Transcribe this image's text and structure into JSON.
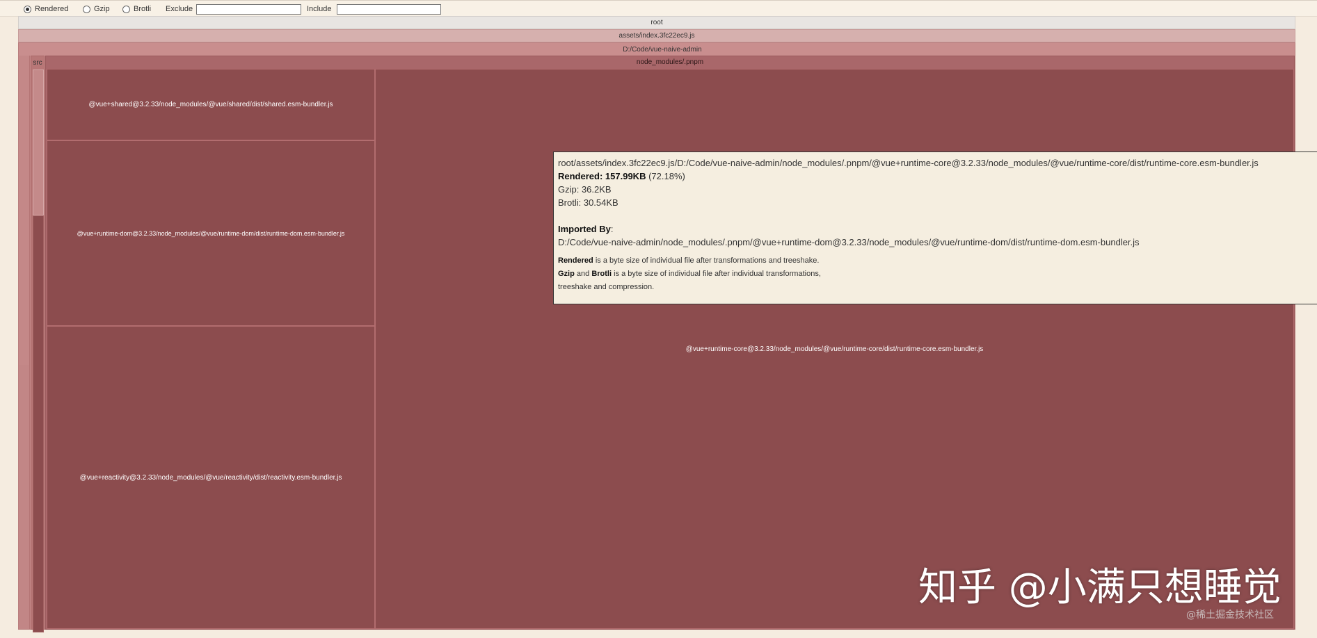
{
  "controls": {
    "size_options": [
      {
        "label": "Rendered",
        "selected": true
      },
      {
        "label": "Gzip",
        "selected": false
      },
      {
        "label": "Brotli",
        "selected": false
      }
    ],
    "exclude_label": "Exclude",
    "exclude_value": "",
    "include_label": "Include",
    "include_value": ""
  },
  "treemap": {
    "root": "root",
    "asset": "assets/index.3fc22ec9.js",
    "project": "D:/Code/vue-naive-admin",
    "src": "src",
    "node_modules": "node_modules/.pnpm",
    "leaves": {
      "shared": "@vue+shared@3.2.33/node_modules/@vue/shared/dist/shared.esm-bundler.js",
      "runtime_dom": "@vue+runtime-dom@3.2.33/node_modules/@vue/runtime-dom/dist/runtime-dom.esm-bundler.js",
      "reactivity": "@vue+reactivity@3.2.33/node_modules/@vue/reactivity/dist/reactivity.esm-bundler.js",
      "runtime_core": "@vue+runtime-core@3.2.33/node_modules/@vue/runtime-core/dist/runtime-core.esm-bundler.js"
    },
    "colors": {
      "root": "#e8e5e2",
      "asset": "#d6b0ae",
      "project": "#c98e8e",
      "node_modules": "#a9676a",
      "leaf": "#8c4c4e"
    }
  },
  "tooltip": {
    "path": "root/assets/index.3fc22ec9.js/D:/Code/vue-naive-admin/node_modules/.pnpm/@vue+runtime-core@3.2.33/node_modules/@vue/runtime-core/dist/runtime-core.esm-bundler.js",
    "rendered_label": "Rendered:",
    "rendered_value": "157.99KB",
    "rendered_percent": "(72.18%)",
    "gzip": "Gzip: 36.2KB",
    "brotli": "Brotli: 30.54KB",
    "imported_by_label": "Imported By",
    "imported_by_value": "D:/Code/vue-naive-admin/node_modules/.pnpm/@vue+runtime-dom@3.2.33/node_modules/@vue/runtime-dom/dist/runtime-dom.esm-bundler.js",
    "note_rendered_term": "Rendered",
    "note_rendered_text": "is a byte size of individual file after transformations and treeshake.",
    "note_gzip_term": "Gzip",
    "note_and": "and",
    "note_brotli_term": "Brotli",
    "note_compressed_text": "is a byte size of individual file after individual transformations,",
    "note_compressed_text_2": "treeshake and compression."
  },
  "watermark": {
    "main": "知乎 @小满只想睡觉",
    "sub": "@稀土掘金技术社区"
  }
}
